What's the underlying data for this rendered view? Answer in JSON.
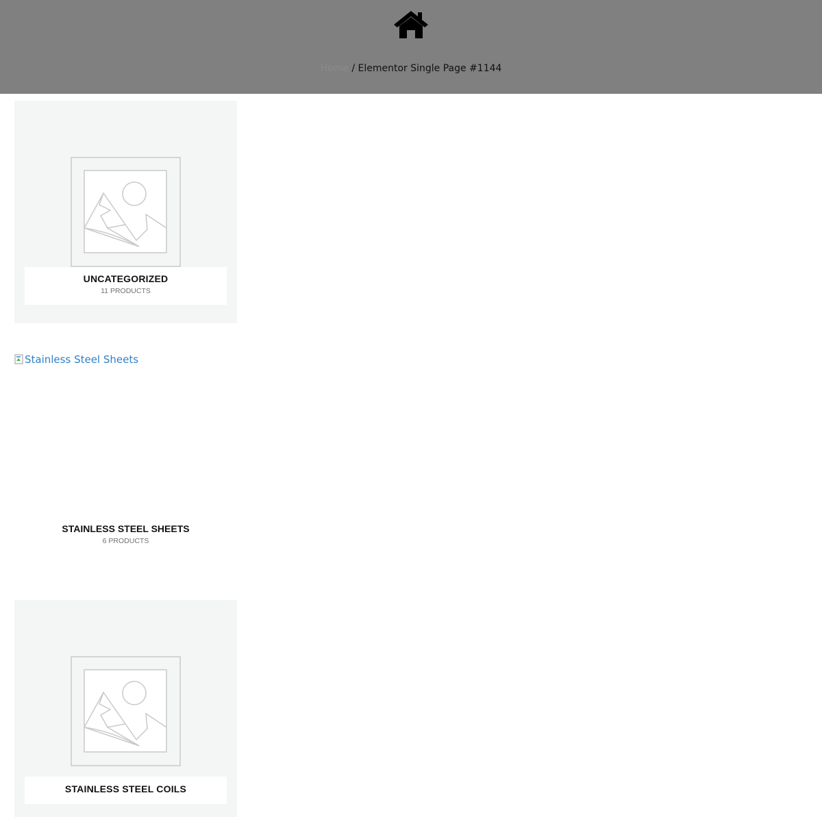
{
  "header": {
    "icon": "home-icon",
    "background_color": "#808080",
    "breadcrumb": {
      "home_label": "Home",
      "separator": "/",
      "current": "Elementor Single Page #1144"
    }
  },
  "categories": [
    {
      "title": "UNCATEGORIZED",
      "count": "11 PRODUCTS",
      "image": "placeholder-image-icon"
    },
    {
      "title": "STAINLESS STEEL SHEETS",
      "count": "6 PRODUCTS",
      "image_alt": "Stainless Steel Sheets"
    },
    {
      "title": "STAINLESS STEEL COILS",
      "image": "placeholder-image-icon"
    }
  ]
}
